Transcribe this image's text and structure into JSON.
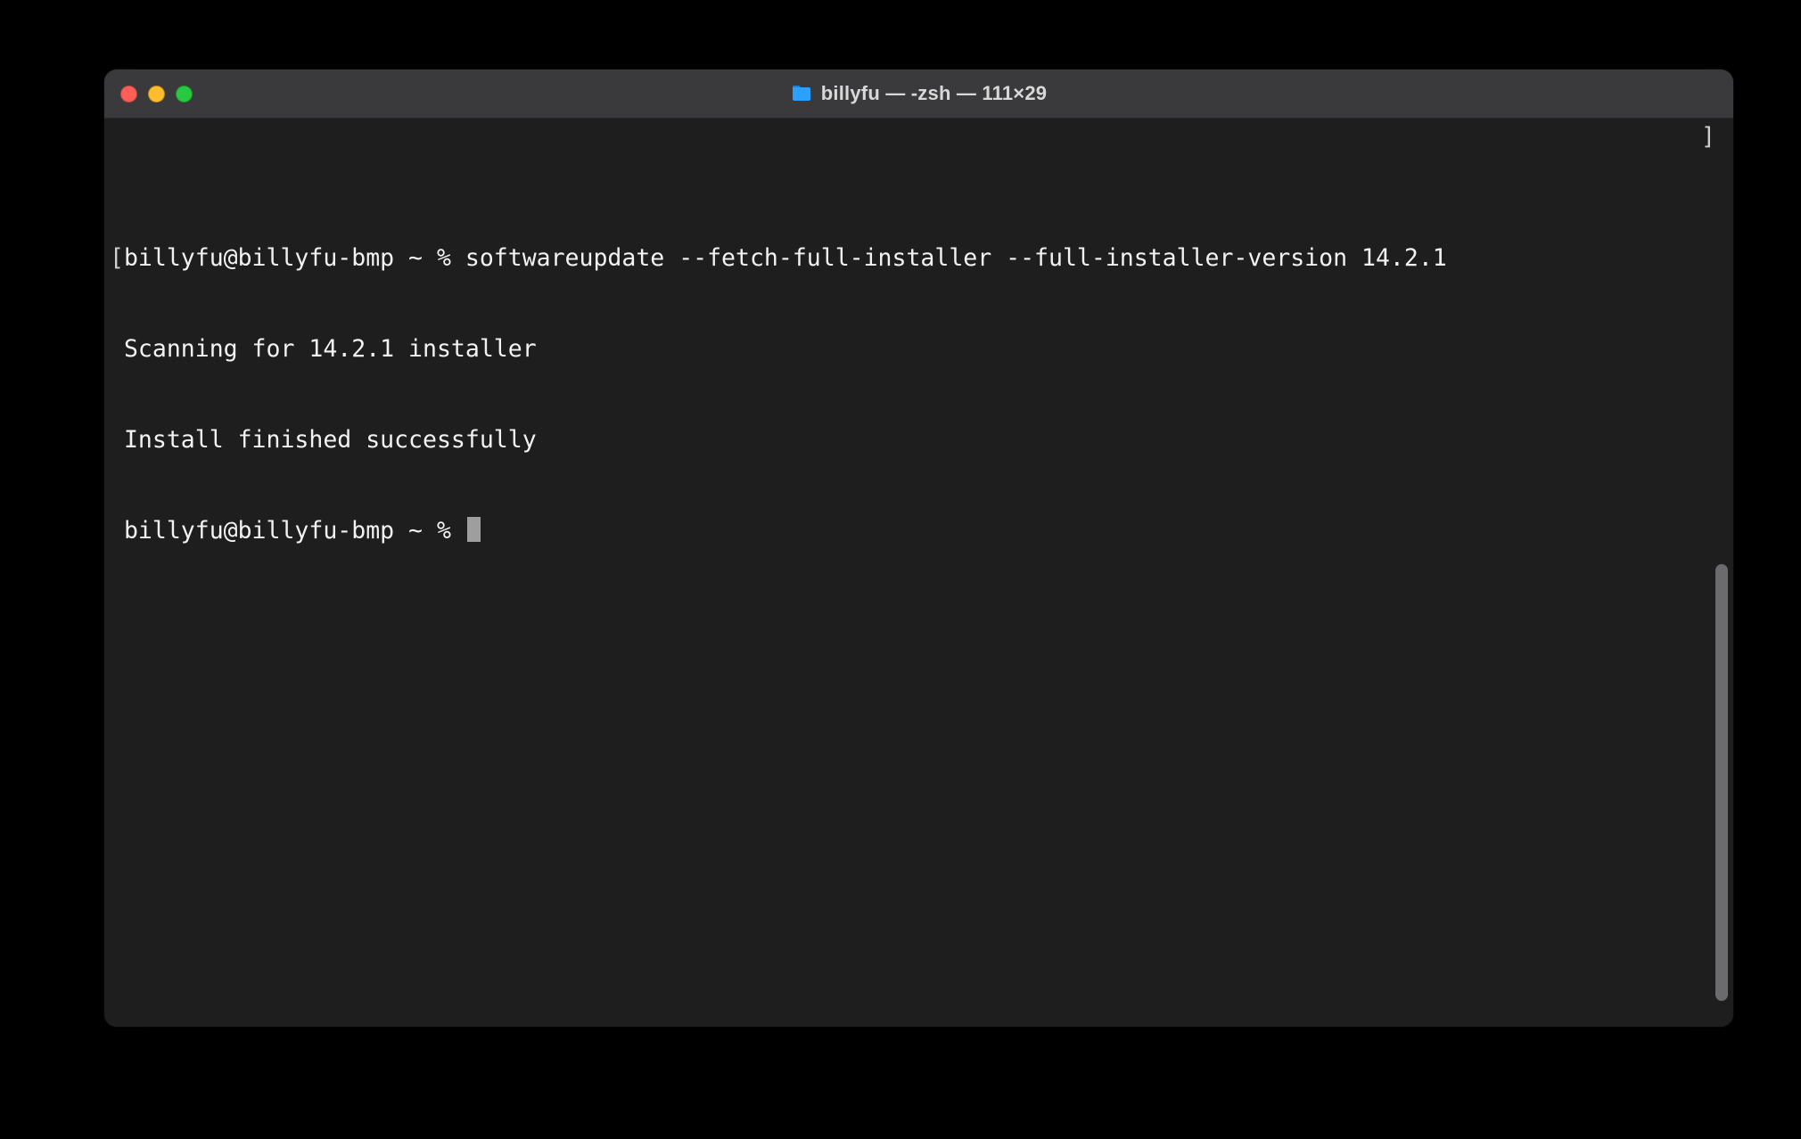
{
  "window": {
    "title": "billyfu — -zsh — 111×29"
  },
  "terminal": {
    "line1_prompt": "billyfu@billyfu-bmp ~ % ",
    "line1_cmd": "softwareupdate --fetch-full-installer --full-installer-version 14.2.1",
    "line2": "Scanning for 14.2.1 installer",
    "line3": "Install finished successfully",
    "line4_prompt": "billyfu@billyfu-bmp ~ % ",
    "left_bracket": "[",
    "right_bracket": "]"
  },
  "colors": {
    "window_bg": "#1e1e1e",
    "titlebar_bg": "#3a3a3c",
    "text": "#f2f2f2",
    "close": "#ff5f57",
    "minimize": "#febc2e",
    "maximize": "#28c840",
    "folder": "#2aa1ff"
  }
}
